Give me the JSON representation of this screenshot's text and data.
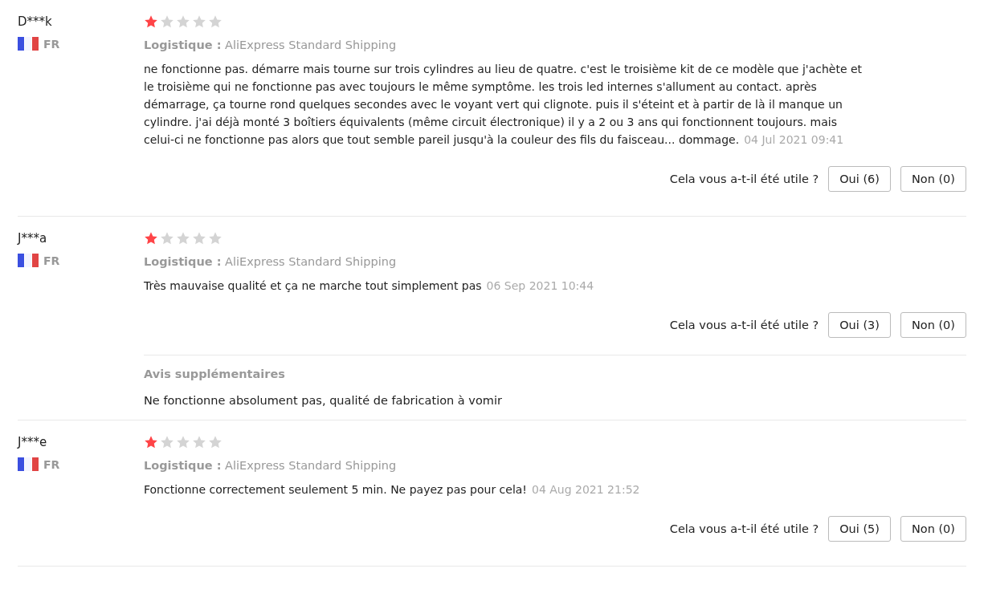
{
  "reviews": [
    {
      "name": "D***k",
      "country": "FR",
      "stars": 1,
      "logistics": "**Logistique :** AliExpress Standard Shipping",
      "text": "ne fonctionne pas. démarre mais tourne sur trois cylindres au lieu de quatre. c'est le troisième kit de ce modèle que j'achète et le troisième qui ne fonctionne pas avec toujours le même symptôme. les trois led internes s'allument au contact. après démarrage, ça tourne rond quelques secondes avec le voyant vert qui clignote. puis il s'éteint et à partir de là il manque un cylindre. j'ai déjà monté 3 boîtiers équivalents (même circuit électronique) il y a 2 ou 3 ans qui fonctionnent toujours. mais celui-ci ne fonctionne pas alors que tout semble pareil jusqu'à la couleur des fils du faisceau... dommage.",
      "date": "04 Jul 2021 09:41",
      "helpful_prompt": "Cela vous a-t-il été utile ?",
      "yes": "Oui (6)",
      "no": "Non (0)"
    },
    {
      "name": "J***a",
      "country": "FR",
      "stars": 1,
      "logistics": "**Logistique :** AliExpress Standard Shipping",
      "text": "Très mauvaise qualité et ça ne marche tout simplement pas",
      "date": "06 Sep 2021 10:44",
      "helpful_prompt": "Cela vous a-t-il été utile ?",
      "yes": "Oui (3)",
      "no": "Non (0)",
      "additional": {
        "title": "Avis supplémentaires",
        "text": "Ne fonctionne absolument pas, qualité de fabrication à vomir"
      }
    },
    {
      "name": "J***e",
      "country": "FR",
      "stars": 1,
      "logistics": "**Logistique :** AliExpress Standard Shipping",
      "text": "Fonctionne correctement seulement 5 min. Ne payez pas pour cela!",
      "date": "04 Aug 2021 21:52",
      "helpful_prompt": "Cela vous a-t-il été utile ?",
      "yes": "Oui (5)",
      "no": "Non (0)"
    }
  ]
}
